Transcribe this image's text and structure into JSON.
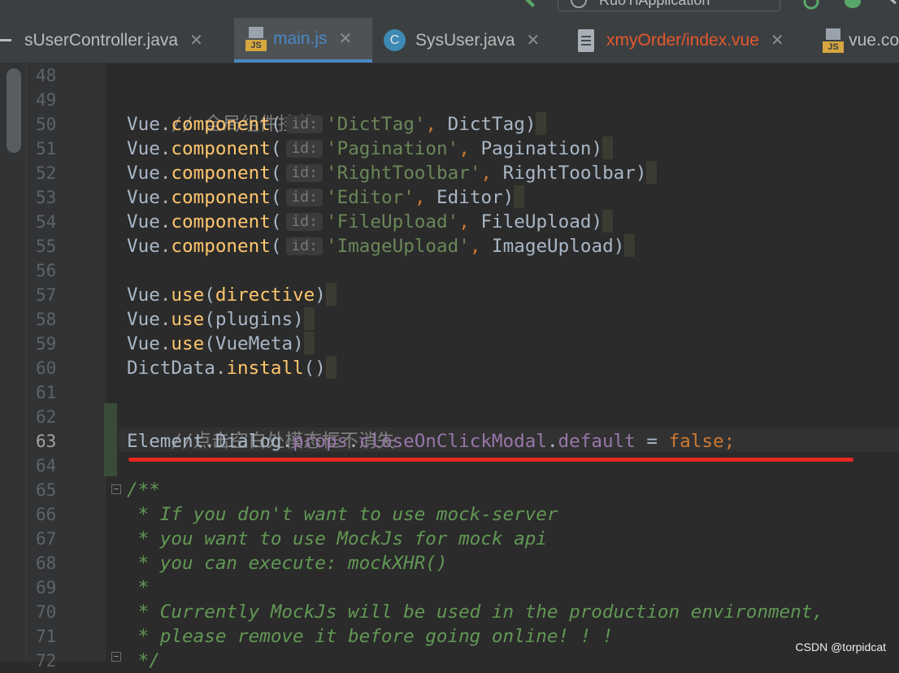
{
  "toolbar": {
    "run_config_label": "RuoYiApplication"
  },
  "tabs": [
    {
      "label": "sUserController.java",
      "icon": "java-class-icon",
      "active": false,
      "color": "#bbbbbb"
    },
    {
      "label": "main.js",
      "icon": "js-file-icon",
      "active": true,
      "color": "#4a88c7"
    },
    {
      "label": "SysUser.java",
      "icon": "java-class-icon",
      "active": false,
      "color": "#bbbbbb"
    },
    {
      "label": "xmyOrder/index.vue",
      "icon": "vue-file-icon",
      "active": false,
      "color": "#e4572e"
    },
    {
      "label": "vue.co",
      "icon": "js-file-icon",
      "active": false,
      "color": "#bbbbbb"
    }
  ],
  "editor": {
    "line_numbers": [
      "48",
      "49",
      "50",
      "51",
      "52",
      "53",
      "54",
      "55",
      "56",
      "57",
      "58",
      "59",
      "60",
      "61",
      "62",
      "63",
      "64",
      "65",
      "66",
      "67",
      "68",
      "69",
      "70",
      "71",
      "72"
    ],
    "current_line": "63",
    "param_hint": "id:",
    "lines": {
      "l49": "// 全局组件挂载",
      "vue": "Vue",
      "component": "component",
      "use": "use",
      "l50_str": "'DictTag'",
      "l50_arg": "DictTag",
      "l51_str": "'Pagination'",
      "l51_arg": "Pagination",
      "l52_str": "'RightToolbar'",
      "l52_arg": "RightToolbar",
      "l53_str": "'Editor'",
      "l53_arg": "Editor",
      "l54_str": "'FileUpload'",
      "l54_arg": "FileUpload",
      "l55_str": "'ImageUpload'",
      "l55_arg": "ImageUpload",
      "l57_arg": "directive",
      "l58_arg": "plugins",
      "l59_arg": "VueMeta",
      "l60_obj": "DictData",
      "l60_method": "install",
      "l62": "//点击空白处模态框不消失",
      "l63_obj": "Element",
      "l63_dialog": "Dialog",
      "l63_props": "props",
      "l63_prop": "closeOnClickModal",
      "l63_default": "default",
      "l63_value": "false",
      "l65": "/**",
      "l66": " * If you don't want to use mock-server",
      "l67": " * you want to use MockJs for mock api",
      "l68": " * you can execute: mockXHR()",
      "l69": " *",
      "l70": " * Currently MockJs will be used in the production environment,",
      "l71": " * please remove it before going online! ! !",
      "l72": " */"
    }
  },
  "watermark": "CSDN @torpidcat"
}
